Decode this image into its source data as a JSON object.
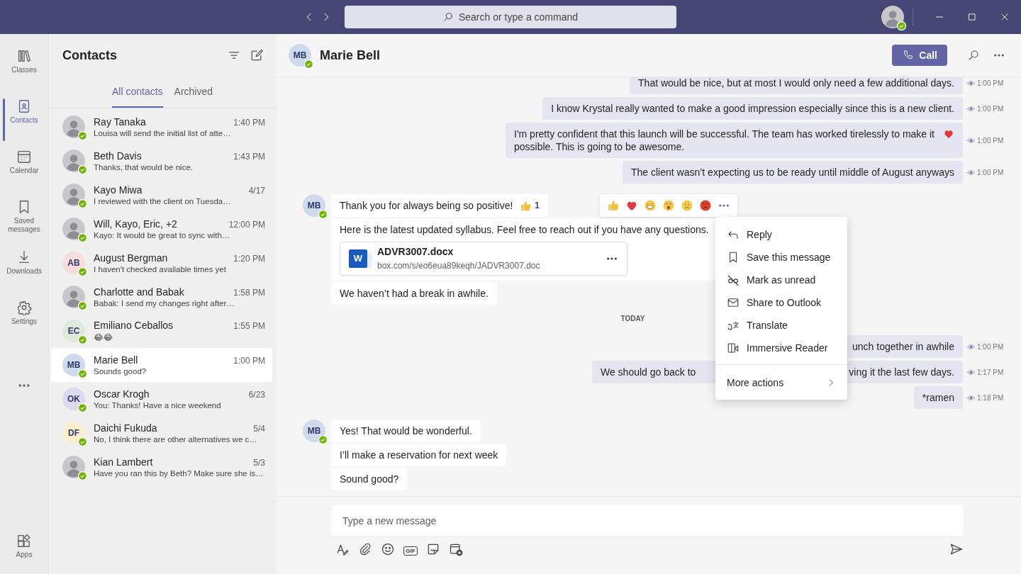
{
  "titlebar": {
    "search": {
      "placeholder": "Search or type a command"
    }
  },
  "rail": [
    {
      "label": "Classes",
      "kind": "books",
      "selected": false
    },
    {
      "label": "Contacts",
      "kind": "contact",
      "selected": true
    },
    {
      "label": "Calendar",
      "kind": "calendar",
      "selected": false
    },
    {
      "label": "Saved messages",
      "kind": "bookmark",
      "selected": false
    },
    {
      "label": "Downloads",
      "kind": "download",
      "selected": false
    },
    {
      "label": "Settings",
      "kind": "gear",
      "selected": false
    }
  ],
  "rail_apps": {
    "label": "Apps",
    "selected": false
  },
  "contacts": {
    "title": "Contacts",
    "tabs": [
      {
        "label": "All contacts",
        "selected": true
      },
      {
        "label": "Archived",
        "selected": false
      }
    ],
    "items": [
      {
        "name": "Ray Tanaka",
        "time": "1:40 PM",
        "preview": "Louisa will send the initial list of atte…",
        "kind": "photo",
        "selected": false
      },
      {
        "name": "Beth Davis",
        "time": "1:43 PM",
        "preview": "Thanks, that would be nice.",
        "kind": "photo",
        "selected": false
      },
      {
        "name": "Kayo Miwa",
        "time": "4/17",
        "preview": "I reviewed with the client on Tuesda…",
        "kind": "photo",
        "selected": false
      },
      {
        "name": "Will, Kayo, Eric, +2",
        "time": "12:00 PM",
        "preview": "Kayo: It would be great to sync with…",
        "kind": "photo",
        "selected": false
      },
      {
        "name": "August Bergman",
        "time": "1:20 PM",
        "preview": "I haven't checked available times yet",
        "kind": "initials",
        "initials": "AB",
        "color": "#f6dede",
        "selected": false
      },
      {
        "name": "Charlotte and Babak",
        "time": "1:58 PM",
        "preview": "Babak: I send my changes right after…",
        "kind": "photo",
        "selected": false
      },
      {
        "name": "Emiliano Ceballos",
        "time": "1:55 PM",
        "preview": "😂😂",
        "kind": "initials",
        "initials": "EC",
        "color": "#e1e8dc",
        "selected": false
      },
      {
        "name": "Marie Bell",
        "time": "1:00 PM",
        "preview": "Sounds good?",
        "kind": "initials",
        "initials": "MB",
        "color": "#d0daed",
        "selected": true
      },
      {
        "name": "Oscar Krogh",
        "time": "6/23",
        "preview": "You: Thanks! Have a nice weekend",
        "kind": "initials",
        "initials": "OK",
        "color": "#ddd9ef",
        "selected": false
      },
      {
        "name": "Daichi Fukuda",
        "time": "5/4",
        "preview": "No, I think there are other alternatives we c…",
        "kind": "initials",
        "initials": "DF",
        "color": "#faeecf",
        "selected": false
      },
      {
        "name": "Kian Lambert",
        "time": "5/3",
        "preview": "Have you ran this by Beth? Make sure she is…",
        "kind": "photo",
        "selected": false
      }
    ]
  },
  "chat": {
    "name": "Marie Bell",
    "initials": "MB",
    "call_label": "Call",
    "messages": [
      {
        "kind": "sent",
        "parts": [
          "That would be nice, but at most I would only need a few additional days."
        ],
        "time": "1:00 PM",
        "heart": false,
        "covered": false
      },
      {
        "kind": "sent",
        "parts": [
          "I know Krystal really wanted to make a good impression especially since this is a new client."
        ],
        "time": "1:00 PM",
        "heart": false,
        "covered": false
      },
      {
        "kind": "sent",
        "parts": [
          "I'm pretty confident that this launch will be successful. The team has worked tirelessly to make it possible. This is going to be awesome."
        ],
        "time": "1:00 PM",
        "heart": true,
        "covered": false
      },
      {
        "kind": "sent",
        "parts": [
          "The client wasn’t expecting us to be ready until middle of August anyways"
        ],
        "time": "1:00 PM",
        "heart": false,
        "covered": false
      },
      {
        "kind": "received",
        "initials": "MB",
        "menu_open": true,
        "bubbles": [
          {
            "text": "Thank you for always being so positive!",
            "reaction_count": "1"
          },
          {
            "text": "Here is the latest updated syllabus. Feel free to reach out if you have any questions.",
            "file": {
              "badge": "W",
              "name": "ADVR3007.docx",
              "link": "box.com/s/eo6eua89keqh/JADVR3007.doc"
            }
          },
          {
            "text": "We haven’t had a break in awhile."
          }
        ]
      },
      {
        "kind": "divider",
        "text": "TODAY"
      },
      {
        "kind": "sent",
        "parts": [
          "unch together in awhile"
        ],
        "time": "1:00 PM",
        "heart": false,
        "covered": true
      },
      {
        "kind": "sent",
        "parts": [
          "We should go back to",
          "ving it the last few days."
        ],
        "time": "1:17 PM",
        "heart": false,
        "covered": false
      },
      {
        "kind": "sent",
        "parts": [
          "*ramen"
        ],
        "time": "1:18 PM",
        "heart": false,
        "covered": false
      },
      {
        "kind": "received",
        "initials": "MB",
        "menu_open": false,
        "bubbles": [
          {
            "text": "Yes! That would be wonderful."
          },
          {
            "text": "I’ll make a reservation for next week"
          },
          {
            "text": "Sound good?"
          }
        ]
      }
    ],
    "menu": {
      "items": [
        {
          "kind": "reply",
          "label": "Reply"
        },
        {
          "kind": "save",
          "label": "Save this message"
        },
        {
          "kind": "unread",
          "label": "Mark as unread"
        },
        {
          "kind": "mail",
          "label": "Share to Outlook"
        },
        {
          "kind": "translate",
          "label": "Translate"
        },
        {
          "kind": "reader",
          "label": "Immersive Reader"
        }
      ],
      "more_label": "More actions"
    },
    "composer": {
      "placeholder": "Type a new message",
      "gif_label": "GIF"
    }
  }
}
